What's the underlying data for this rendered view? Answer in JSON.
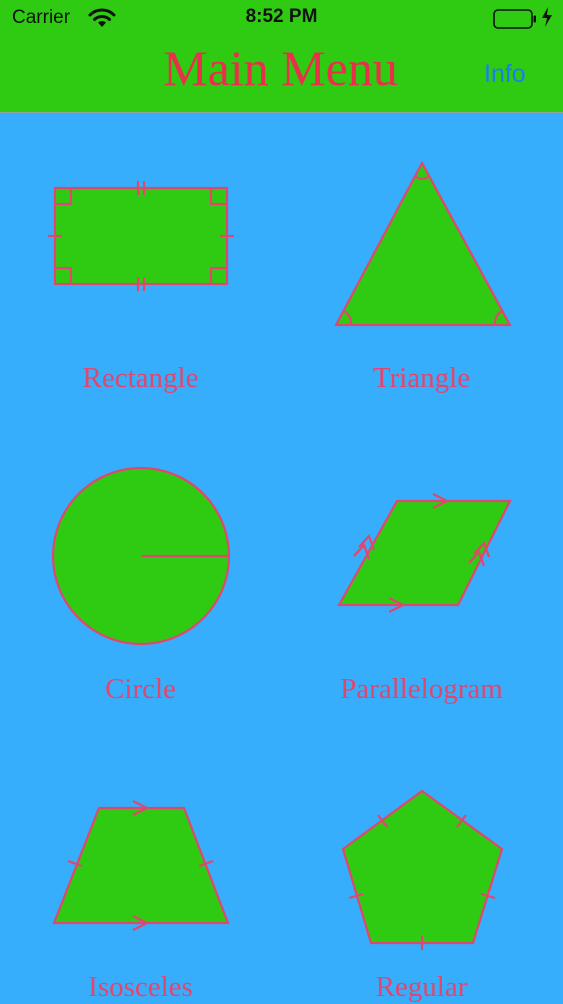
{
  "status_bar": {
    "carrier": "Carrier",
    "time": "8:52 PM"
  },
  "nav": {
    "title": "Main Menu",
    "info_label": "Info"
  },
  "colors": {
    "background": "#36aefc",
    "nav_bar": "#2ecb12",
    "shape_fill": "#2ecb12",
    "shape_stroke": "#e0476f",
    "title": "#e8304b",
    "info": "#1e7cf2"
  },
  "menu": {
    "items": [
      {
        "label": "Rectangle",
        "icon": "rectangle-icon"
      },
      {
        "label": "Triangle",
        "icon": "triangle-icon"
      },
      {
        "label": "Circle",
        "icon": "circle-icon"
      },
      {
        "label": "Parallelogram",
        "icon": "parallelogram-icon"
      },
      {
        "label": "Isosceles",
        "icon": "isosceles-trapezoid-icon"
      },
      {
        "label": "Regular",
        "icon": "regular-pentagon-icon"
      }
    ]
  }
}
